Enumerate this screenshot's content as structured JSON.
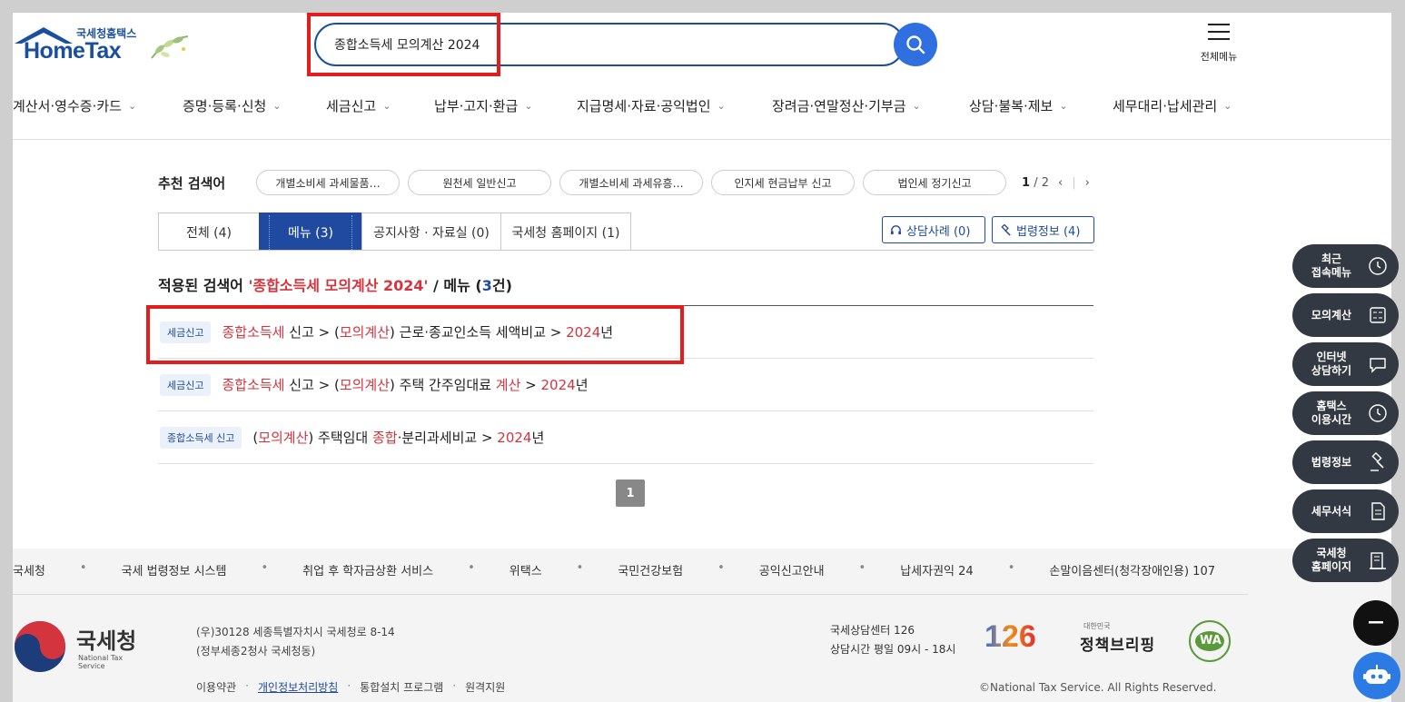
{
  "header": {
    "logo_sub": "국세청홈택스",
    "logo_main": "HomeTax",
    "search_value": "종합소득세 모의계산 2024",
    "all_menu_label": "전체메뉴",
    "nav": [
      "계산서·영수증·카드",
      "증명·등록·신청",
      "세금신고",
      "납부·고지·환급",
      "지급명세·자료·공익법인",
      "장려금·연말정산·기부금",
      "상담·불복·제보",
      "세무대리·납세관리"
    ]
  },
  "recommend": {
    "title": "추천 검색어",
    "chips": [
      "개별소비세 과세물품…",
      "원천세 일반신고",
      "개별소비세 과세유흥…",
      "인지세 현금납부 신고",
      "법인세 정기신고"
    ],
    "page": "1",
    "page_sep": "/",
    "page_total": "2"
  },
  "tabs": [
    {
      "label": "전체 (4)"
    },
    {
      "label": "메뉴 (3)"
    },
    {
      "label": "공지사항 · 자료실 (0)"
    },
    {
      "label": "국세청 홈페이지 (1)"
    }
  ],
  "tab_buttons": {
    "consult": "상담사례 (0)",
    "law": "법령정보 (4)"
  },
  "applied": {
    "prefix": "적용된 검색어 ",
    "term": "'종합소득세 모의계산 2024'",
    "mid": " / 메뉴 (",
    "count": "3",
    "suffix": "건)"
  },
  "results": [
    {
      "badge": "세금신고",
      "parts": [
        [
          "종합소득세",
          true
        ],
        [
          " 신고 > (",
          false
        ],
        [
          "모의계산",
          true
        ],
        [
          ") 근로·종교인소득 세액비교 > ",
          false
        ],
        [
          "2024",
          true
        ],
        [
          "년",
          false
        ]
      ]
    },
    {
      "badge": "세금신고",
      "parts": [
        [
          "종합소득세",
          true
        ],
        [
          " 신고 > (",
          false
        ],
        [
          "모의계산",
          true
        ],
        [
          ") 주택 간주임대료 ",
          false
        ],
        [
          "계산",
          true
        ],
        [
          " > ",
          false
        ],
        [
          "2024",
          true
        ],
        [
          "년",
          false
        ]
      ]
    },
    {
      "badge": "종합소득세 신고",
      "parts": [
        [
          "(",
          false
        ],
        [
          "모의계산",
          true
        ],
        [
          ") 주택임대 ",
          false
        ],
        [
          "종합",
          true
        ],
        [
          "·분리과세비교 > ",
          false
        ],
        [
          "2024",
          true
        ],
        [
          "년",
          false
        ]
      ]
    }
  ],
  "pagination": {
    "current": "1"
  },
  "quick_menu": [
    "최근\n접속메뉴",
    "모의계산",
    "인터넷\n상담하기",
    "홈택스\n이용시간",
    "법령정보",
    "세무서식",
    "국세청\n홈페이지"
  ],
  "footer": {
    "links": [
      "국세청",
      "국세 법령정보 시스템",
      "취업 후 학자금상환 서비스",
      "위택스",
      "국민건강보험",
      "공익신고안내",
      "납세자권익 24",
      "손말이음센터(청각장애인용) 107"
    ],
    "nts_kr": "국세청",
    "nts_en": "National Tax Service",
    "address1": "(우)30128 세종특별자치시 국세청로 8-14",
    "address2": "(정부세종2청사 국세청동)",
    "bottom_links": [
      "이용약관",
      "개인정보처리방침",
      "통합설치 프로그램",
      "원격지원"
    ],
    "center_title": "국세상담센터 126",
    "center_hours": "상담시간 평일 09시 - 18시",
    "logo_126": "126",
    "policy_small": "대한민국",
    "policy_big": "정책브리핑",
    "wa_text": "WA",
    "copyright": "©National Tax Service. All Rights Reserved."
  }
}
